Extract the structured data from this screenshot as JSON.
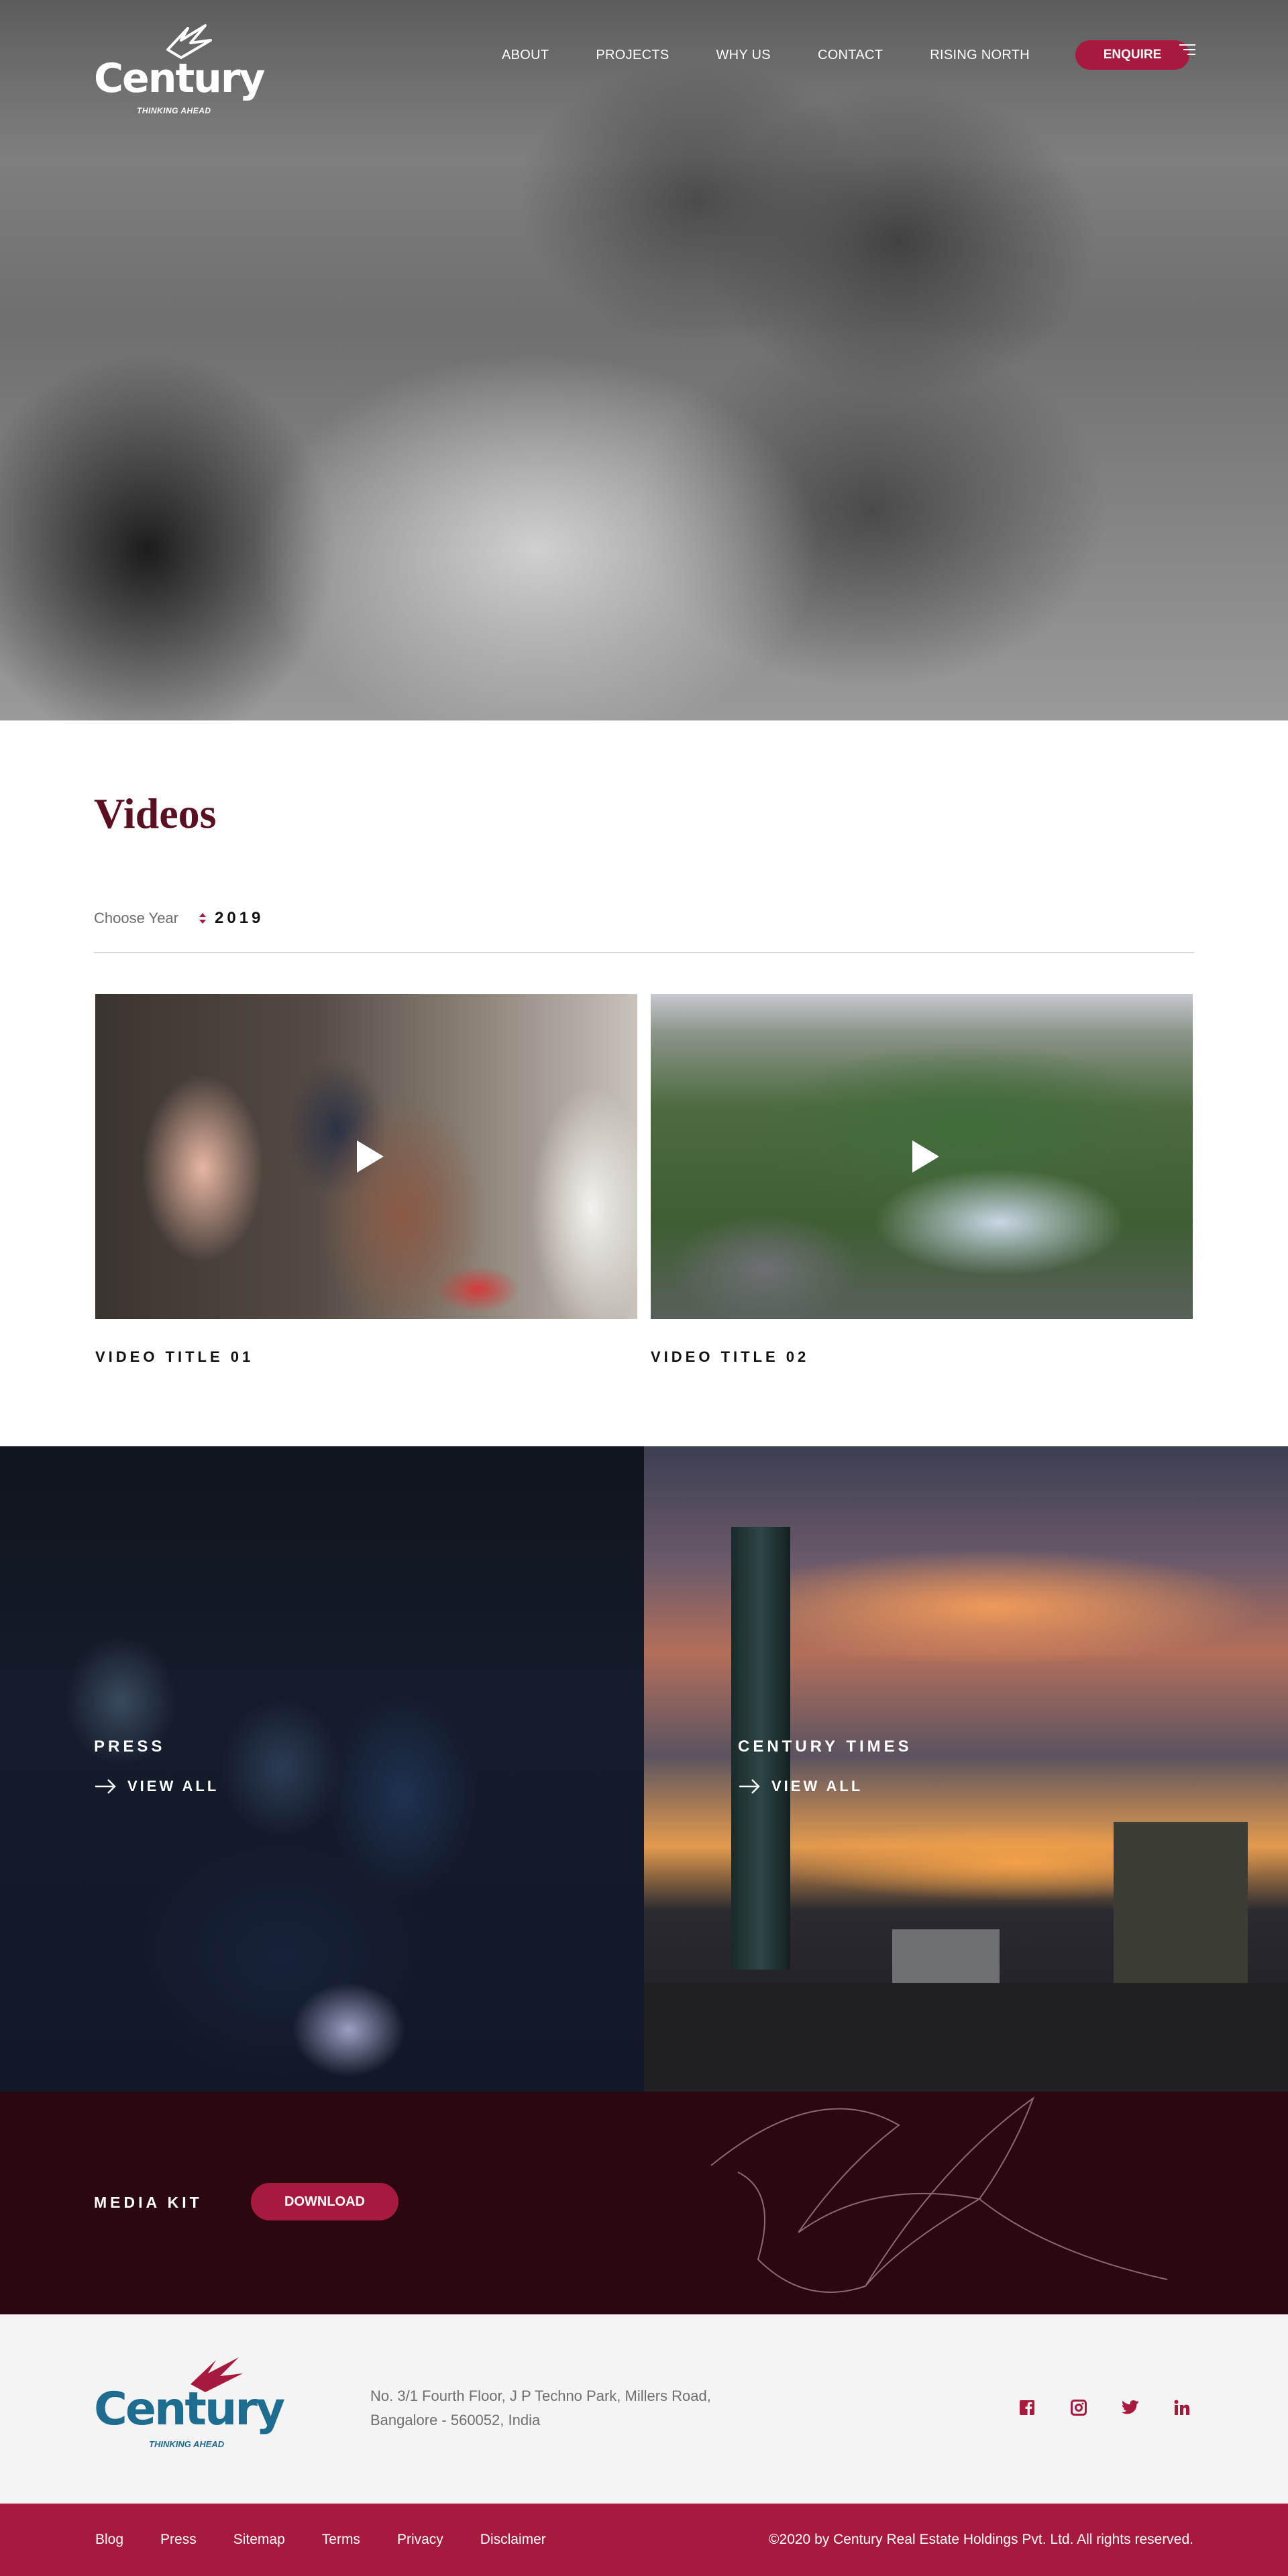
{
  "header": {
    "logo": {
      "wordmark": "Century",
      "tagline": "THINKING AHEAD"
    },
    "nav": [
      "ABOUT",
      "PROJECTS",
      "WHY US",
      "CONTACT",
      "RISING NORTH"
    ],
    "enquire_label": "ENQUIRE",
    "menu_icon": "hamburger-menu-icon"
  },
  "videos": {
    "title": "Videos",
    "year_label": "Choose Year",
    "year_value": "2019",
    "items": [
      {
        "title": "VIDEO TITLE 01",
        "icon": "play-icon"
      },
      {
        "title": "VIDEO TITLE 02",
        "icon": "play-icon"
      }
    ]
  },
  "press": {
    "title": "PRESS",
    "link_label": "VIEW ALL",
    "icon": "arrow-right-icon"
  },
  "times": {
    "title": "CENTURY TIMES",
    "link_label": "VIEW ALL",
    "icon": "arrow-right-icon"
  },
  "media_kit": {
    "label": "MEDIA KIT",
    "button_label": "DOWNLOAD"
  },
  "footer": {
    "logo": {
      "wordmark": "Century",
      "tagline": "THINKING AHEAD"
    },
    "address_line1": "No. 3/1 Fourth Floor, J P Techno Park, Millers Road,",
    "address_line2": "Bangalore - 560052, India",
    "socials": [
      "facebook-icon",
      "instagram-icon",
      "twitter-icon",
      "linkedin-icon"
    ],
    "links": [
      "Blog",
      "Press",
      "Sitemap",
      "Terms",
      "Privacy",
      "Disclaimer"
    ],
    "copyright": "©2020 by Century Real Estate Holdings Pvt. Ltd. All rights reserved."
  },
  "colors": {
    "brand_red": "#a81a3d",
    "maroon": "#2b0811",
    "title_maroon": "#5a0f22",
    "logo_blue": "#1e6c8f"
  }
}
